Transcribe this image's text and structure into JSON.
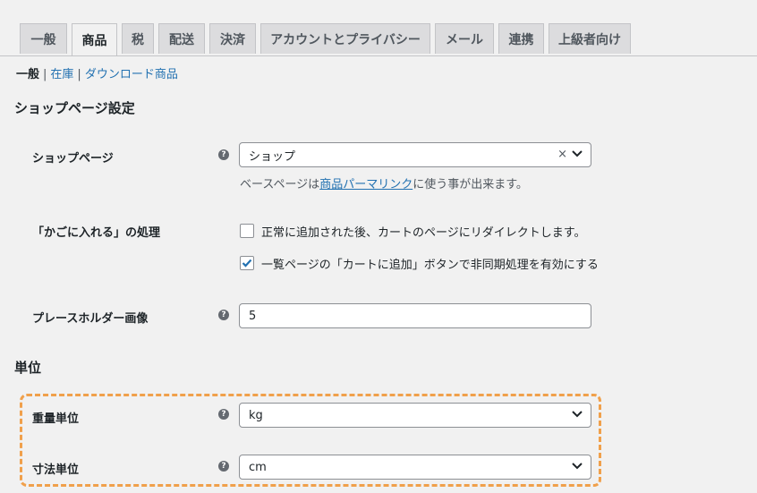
{
  "tabs": [
    {
      "label": "一般"
    },
    {
      "label": "商品"
    },
    {
      "label": "税"
    },
    {
      "label": "配送"
    },
    {
      "label": "決済"
    },
    {
      "label": "アカウントとプライバシー"
    },
    {
      "label": "メール"
    },
    {
      "label": "連携"
    },
    {
      "label": "上級者向け"
    }
  ],
  "subnav": {
    "current": "一般",
    "sep": "|",
    "links": [
      "在庫",
      "ダウンロード商品"
    ]
  },
  "shop_section": {
    "title": "ショップページ設定",
    "shop_page": {
      "label": "ショップページ",
      "value": "ショップ",
      "clear": "×",
      "desc_before": "ベースページは",
      "desc_link": "商品パーマリンク",
      "desc_after": "に使う事が出来ます。"
    },
    "add_to_cart": {
      "label": "「かごに入れる」の処理",
      "options": [
        {
          "text": "正常に追加された後、カートのページにリダイレクトします。",
          "checked": false
        },
        {
          "text": "一覧ページの「カートに追加」ボタンで非同期処理を有効にする",
          "checked": true
        }
      ]
    },
    "placeholder": {
      "label": "プレースホルダー画像",
      "value": "5"
    }
  },
  "units_section": {
    "title": "単位",
    "weight": {
      "label": "重量単位",
      "value": "kg"
    },
    "dimension": {
      "label": "寸法単位",
      "value": "cm"
    }
  },
  "help_glyph": "?",
  "colors": {
    "link": "#2271b1",
    "highlight": "#f0a04b",
    "checkbox_check": "#2271b1"
  }
}
